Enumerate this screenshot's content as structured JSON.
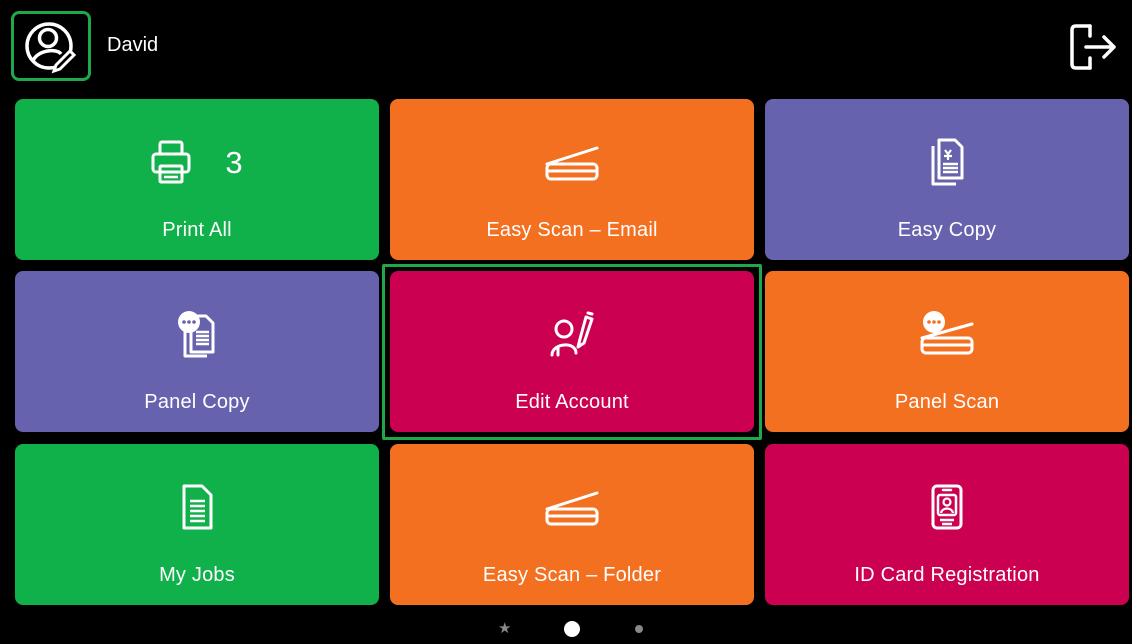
{
  "header": {
    "user_name": "David",
    "user_icon": "user-edit-icon",
    "logout_icon": "logout-icon"
  },
  "colors": {
    "green": "#10b04a",
    "orange": "#f37021",
    "purple": "#6762ad",
    "crimson": "#cc0050",
    "selection": "#1fa84a"
  },
  "tiles": [
    {
      "label": "Print All",
      "icon": "printer-icon",
      "count": "3",
      "color": "#10b04a"
    },
    {
      "label": "Easy Scan – Email",
      "icon": "scanner-icon",
      "color": "#f37021"
    },
    {
      "label": "Easy Copy",
      "icon": "copy-document-icon",
      "color": "#6762ad"
    },
    {
      "label": "Panel Copy",
      "icon": "panel-copy-icon",
      "color": "#6762ad"
    },
    {
      "label": "Edit Account",
      "icon": "edit-account-icon",
      "color": "#cc0050",
      "selected": true
    },
    {
      "label": "Panel Scan",
      "icon": "panel-scan-icon",
      "color": "#f37021"
    },
    {
      "label": "My Jobs",
      "icon": "document-list-icon",
      "color": "#10b04a"
    },
    {
      "label": "Easy Scan – Folder",
      "icon": "scanner-icon",
      "color": "#f37021"
    },
    {
      "label": "ID Card Registration",
      "icon": "id-card-icon",
      "color": "#cc0050"
    }
  ],
  "pager": {
    "pages": 3,
    "current": 2,
    "first_is_favorites": true
  }
}
